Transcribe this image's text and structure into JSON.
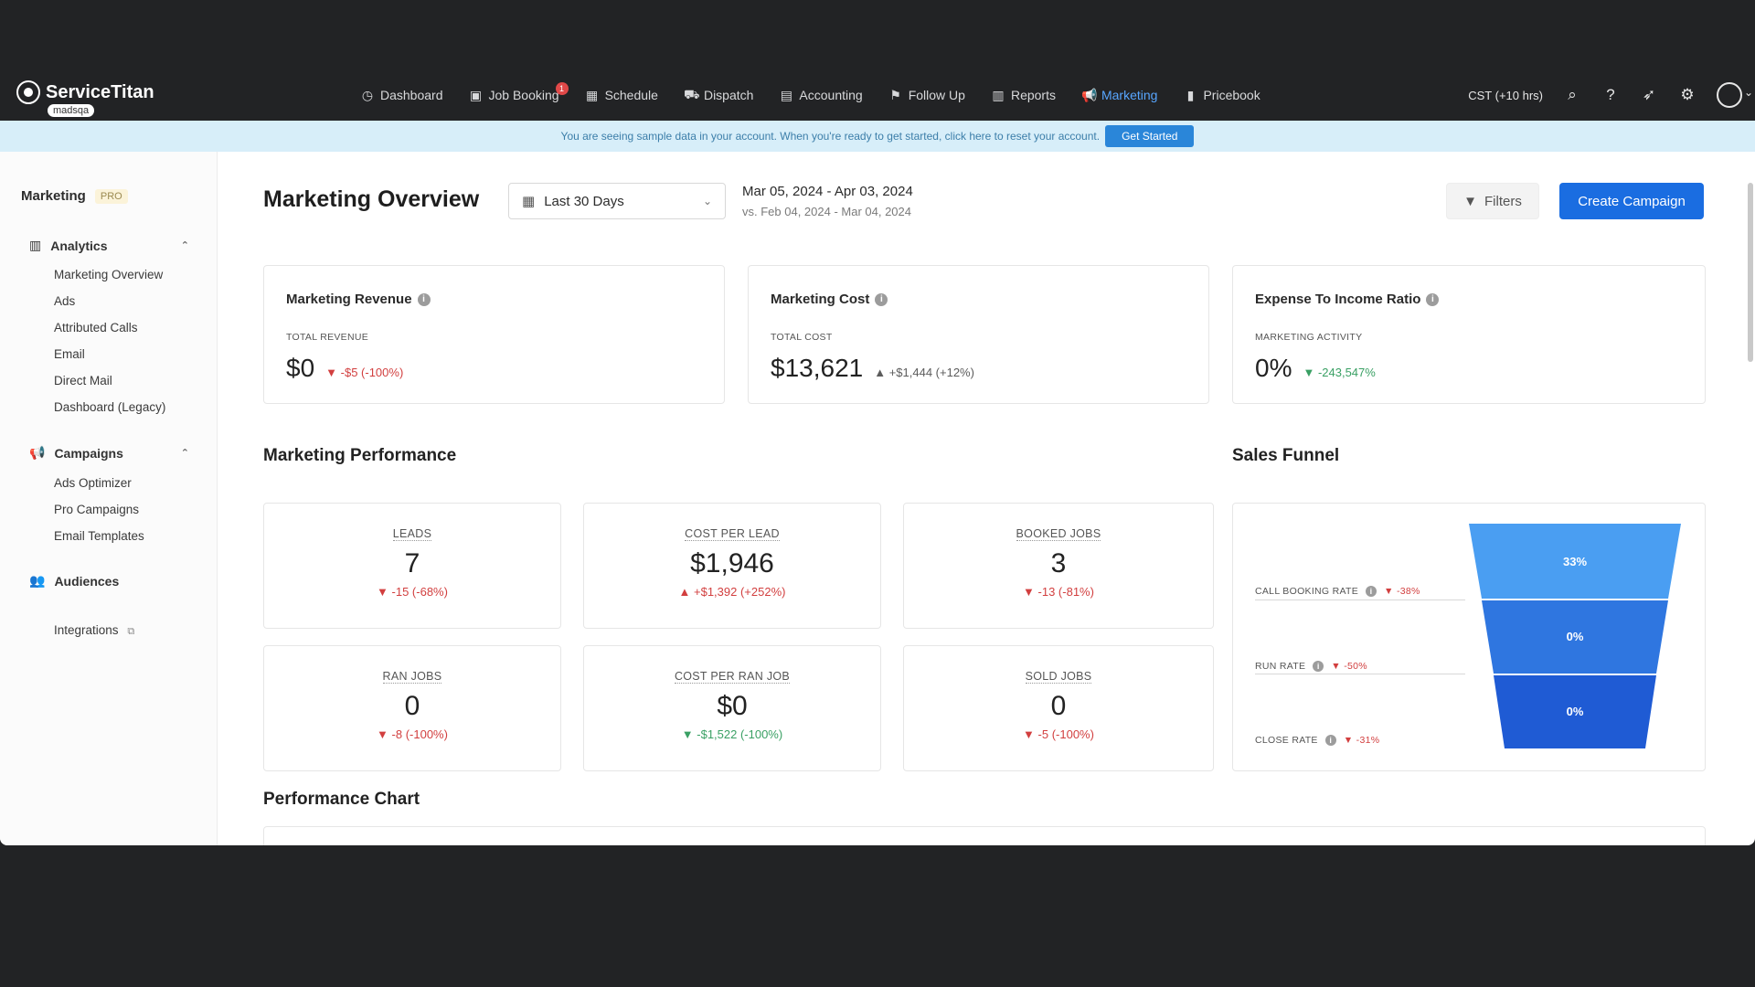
{
  "app": {
    "brand": "ServiceTitan",
    "tenant": "madsqa",
    "nav": [
      {
        "label": "Dashboard",
        "icon": "dashboard-icon"
      },
      {
        "label": "Job Booking",
        "icon": "briefcase-icon",
        "badge": "1"
      },
      {
        "label": "Schedule",
        "icon": "calendar-icon"
      },
      {
        "label": "Dispatch",
        "icon": "truck-icon"
      },
      {
        "label": "Accounting",
        "icon": "ledger-icon"
      },
      {
        "label": "Follow Up",
        "icon": "flag-icon"
      },
      {
        "label": "Reports",
        "icon": "chart-icon"
      },
      {
        "label": "Marketing",
        "icon": "megaphone-icon",
        "active": true
      },
      {
        "label": "Pricebook",
        "icon": "book-icon"
      }
    ],
    "timezone": "CST (+10 hrs)"
  },
  "banner": {
    "text": "You are seeing sample data in your account. When you're ready to get started, click here to reset your account.",
    "button": "Get Started"
  },
  "sidebar": {
    "title": "Marketing",
    "badge": "PRO",
    "analytics": {
      "label": "Analytics",
      "items": [
        "Marketing Overview",
        "Ads",
        "Attributed Calls",
        "Email",
        "Direct Mail",
        "Dashboard (Legacy)"
      ]
    },
    "campaigns": {
      "label": "Campaigns",
      "items": [
        "Ads Optimizer",
        "Pro Campaigns",
        "Email Templates"
      ]
    },
    "audiences": "Audiences",
    "integrations": "Integrations"
  },
  "header": {
    "title": "Marketing Overview",
    "date_range": "Last 30 Days",
    "range": "Mar 05, 2024 - Apr 03, 2024",
    "vs": "vs. Feb 04, 2024 - Mar 04, 2024",
    "filters": "Filters",
    "create": "Create Campaign"
  },
  "kpis": [
    {
      "title": "Marketing Revenue",
      "sub": "TOTAL REVENUE",
      "value": "$0",
      "delta": "▼ -$5 (-100%)",
      "tone": "neg"
    },
    {
      "title": "Marketing Cost",
      "sub": "TOTAL COST",
      "value": "$13,621",
      "delta": "▲ +$1,444 (+12%)",
      "tone": "neutral"
    },
    {
      "title": "Expense To Income Ratio",
      "sub": "MARKETING ACTIVITY",
      "value": "0%",
      "delta": "▼ -243,547%",
      "tone": "pos"
    }
  ],
  "performance": {
    "title": "Marketing Performance",
    "cards": [
      {
        "label": "LEADS",
        "value": "7",
        "delta": "▼ -15 (-68%)",
        "tone": "neg"
      },
      {
        "label": "COST PER LEAD",
        "value": "$1,946",
        "delta": "▲ +$1,392 (+252%)",
        "tone": "neg"
      },
      {
        "label": "BOOKED JOBS",
        "value": "3",
        "delta": "▼ -13 (-81%)",
        "tone": "neg"
      },
      {
        "label": "RAN JOBS",
        "value": "0",
        "delta": "▼ -8 (-100%)",
        "tone": "neg"
      },
      {
        "label": "COST PER RAN JOB",
        "value": "$0",
        "delta": "▼ -$1,522 (-100%)",
        "tone": "pos"
      },
      {
        "label": "SOLD JOBS",
        "value": "0",
        "delta": "▼ -5 (-100%)",
        "tone": "neg"
      }
    ]
  },
  "funnel": {
    "title": "Sales Funnel",
    "rows": [
      {
        "label": "CALL BOOKING RATE",
        "delta": "▼ -38%",
        "value": "33%",
        "color": "#4a9ef2"
      },
      {
        "label": "RUN RATE",
        "delta": "▼ -50%",
        "value": "0%",
        "color": "#2f76e0"
      },
      {
        "label": "CLOSE RATE",
        "delta": "▼ -31%",
        "value": "0%",
        "color": "#1f5bd4"
      }
    ]
  },
  "chart": {
    "title": "Performance Chart"
  }
}
